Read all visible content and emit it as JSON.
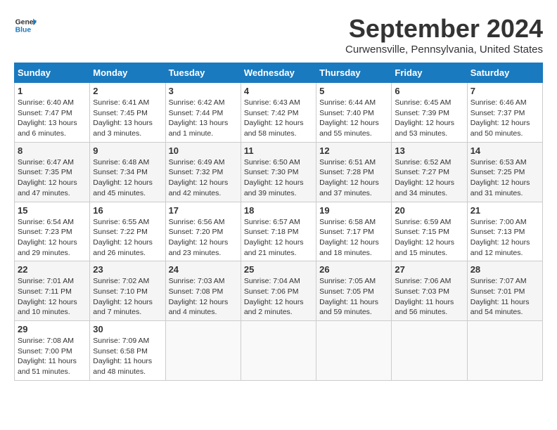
{
  "header": {
    "logo_line1": "General",
    "logo_line2": "Blue",
    "month_title": "September 2024",
    "location": "Curwensville, Pennsylvania, United States"
  },
  "weekdays": [
    "Sunday",
    "Monday",
    "Tuesday",
    "Wednesday",
    "Thursday",
    "Friday",
    "Saturday"
  ],
  "weeks": [
    [
      {
        "day": "1",
        "info": "Sunrise: 6:40 AM\nSunset: 7:47 PM\nDaylight: 13 hours and 6 minutes."
      },
      {
        "day": "2",
        "info": "Sunrise: 6:41 AM\nSunset: 7:45 PM\nDaylight: 13 hours and 3 minutes."
      },
      {
        "day": "3",
        "info": "Sunrise: 6:42 AM\nSunset: 7:44 PM\nDaylight: 13 hours and 1 minute."
      },
      {
        "day": "4",
        "info": "Sunrise: 6:43 AM\nSunset: 7:42 PM\nDaylight: 12 hours and 58 minutes."
      },
      {
        "day": "5",
        "info": "Sunrise: 6:44 AM\nSunset: 7:40 PM\nDaylight: 12 hours and 55 minutes."
      },
      {
        "day": "6",
        "info": "Sunrise: 6:45 AM\nSunset: 7:39 PM\nDaylight: 12 hours and 53 minutes."
      },
      {
        "day": "7",
        "info": "Sunrise: 6:46 AM\nSunset: 7:37 PM\nDaylight: 12 hours and 50 minutes."
      }
    ],
    [
      {
        "day": "8",
        "info": "Sunrise: 6:47 AM\nSunset: 7:35 PM\nDaylight: 12 hours and 47 minutes."
      },
      {
        "day": "9",
        "info": "Sunrise: 6:48 AM\nSunset: 7:34 PM\nDaylight: 12 hours and 45 minutes."
      },
      {
        "day": "10",
        "info": "Sunrise: 6:49 AM\nSunset: 7:32 PM\nDaylight: 12 hours and 42 minutes."
      },
      {
        "day": "11",
        "info": "Sunrise: 6:50 AM\nSunset: 7:30 PM\nDaylight: 12 hours and 39 minutes."
      },
      {
        "day": "12",
        "info": "Sunrise: 6:51 AM\nSunset: 7:28 PM\nDaylight: 12 hours and 37 minutes."
      },
      {
        "day": "13",
        "info": "Sunrise: 6:52 AM\nSunset: 7:27 PM\nDaylight: 12 hours and 34 minutes."
      },
      {
        "day": "14",
        "info": "Sunrise: 6:53 AM\nSunset: 7:25 PM\nDaylight: 12 hours and 31 minutes."
      }
    ],
    [
      {
        "day": "15",
        "info": "Sunrise: 6:54 AM\nSunset: 7:23 PM\nDaylight: 12 hours and 29 minutes."
      },
      {
        "day": "16",
        "info": "Sunrise: 6:55 AM\nSunset: 7:22 PM\nDaylight: 12 hours and 26 minutes."
      },
      {
        "day": "17",
        "info": "Sunrise: 6:56 AM\nSunset: 7:20 PM\nDaylight: 12 hours and 23 minutes."
      },
      {
        "day": "18",
        "info": "Sunrise: 6:57 AM\nSunset: 7:18 PM\nDaylight: 12 hours and 21 minutes."
      },
      {
        "day": "19",
        "info": "Sunrise: 6:58 AM\nSunset: 7:17 PM\nDaylight: 12 hours and 18 minutes."
      },
      {
        "day": "20",
        "info": "Sunrise: 6:59 AM\nSunset: 7:15 PM\nDaylight: 12 hours and 15 minutes."
      },
      {
        "day": "21",
        "info": "Sunrise: 7:00 AM\nSunset: 7:13 PM\nDaylight: 12 hours and 12 minutes."
      }
    ],
    [
      {
        "day": "22",
        "info": "Sunrise: 7:01 AM\nSunset: 7:11 PM\nDaylight: 12 hours and 10 minutes."
      },
      {
        "day": "23",
        "info": "Sunrise: 7:02 AM\nSunset: 7:10 PM\nDaylight: 12 hours and 7 minutes."
      },
      {
        "day": "24",
        "info": "Sunrise: 7:03 AM\nSunset: 7:08 PM\nDaylight: 12 hours and 4 minutes."
      },
      {
        "day": "25",
        "info": "Sunrise: 7:04 AM\nSunset: 7:06 PM\nDaylight: 12 hours and 2 minutes."
      },
      {
        "day": "26",
        "info": "Sunrise: 7:05 AM\nSunset: 7:05 PM\nDaylight: 11 hours and 59 minutes."
      },
      {
        "day": "27",
        "info": "Sunrise: 7:06 AM\nSunset: 7:03 PM\nDaylight: 11 hours and 56 minutes."
      },
      {
        "day": "28",
        "info": "Sunrise: 7:07 AM\nSunset: 7:01 PM\nDaylight: 11 hours and 54 minutes."
      }
    ],
    [
      {
        "day": "29",
        "info": "Sunrise: 7:08 AM\nSunset: 7:00 PM\nDaylight: 11 hours and 51 minutes."
      },
      {
        "day": "30",
        "info": "Sunrise: 7:09 AM\nSunset: 6:58 PM\nDaylight: 11 hours and 48 minutes."
      },
      {
        "day": "",
        "info": ""
      },
      {
        "day": "",
        "info": ""
      },
      {
        "day": "",
        "info": ""
      },
      {
        "day": "",
        "info": ""
      },
      {
        "day": "",
        "info": ""
      }
    ]
  ]
}
